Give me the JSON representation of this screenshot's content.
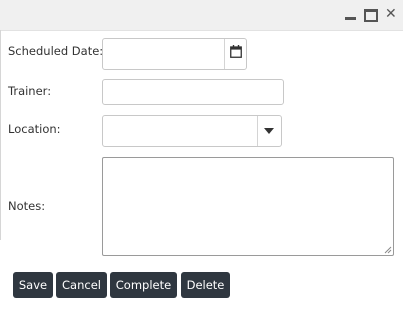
{
  "window": {
    "minimize_icon": "minimize-icon",
    "maximize_icon": "maximize-icon",
    "close_icon": "close-icon",
    "close_glyph": "✕"
  },
  "form": {
    "scheduled_date": {
      "label": "Scheduled Date:",
      "value": "",
      "icon": "calendar-icon"
    },
    "trainer": {
      "label": "Trainer:",
      "value": ""
    },
    "location": {
      "label": "Location:",
      "selected": "",
      "icon": "chevron-down-icon"
    },
    "notes": {
      "label": "Notes:",
      "value": ""
    }
  },
  "buttons": {
    "save": "Save",
    "cancel": "Cancel",
    "complete": "Complete",
    "delete": "Delete"
  },
  "colors": {
    "button_bg": "#2f3740",
    "button_text": "#ffffff",
    "titlebar_bg": "#f0f0f0"
  }
}
